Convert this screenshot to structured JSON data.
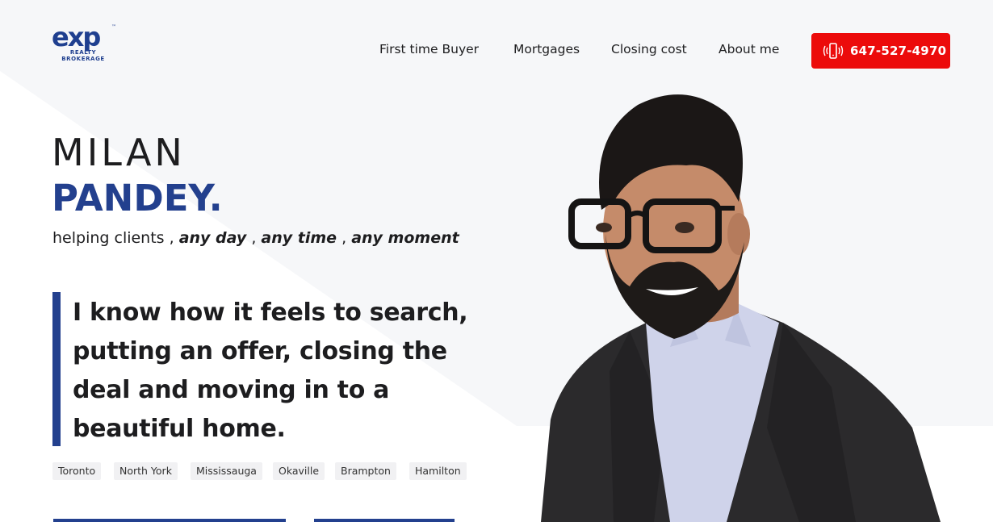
{
  "brand": {
    "logo_text": "exp",
    "logo_sub_line1": "REALTY",
    "logo_sub_line2": "BROKERAGE",
    "logo_tm": "™",
    "colors": {
      "primary": "#23408e",
      "accent": "#ec0b0b",
      "text": "#1d1d1f"
    }
  },
  "nav": {
    "items": [
      {
        "label": "First time Buyer"
      },
      {
        "label": "Mortgages"
      },
      {
        "label": "Closing cost"
      },
      {
        "label": "About me"
      }
    ],
    "phone_icon": "mobile-phone-ringing-icon",
    "phone": "647-527-4970"
  },
  "hero": {
    "first_name": "MILAN",
    "last_name": "PANDEY.",
    "tagline_prefix": "helping clients ,",
    "tagline_1": "any day",
    "tagline_sep1": ",",
    "tagline_2": "any time",
    "tagline_sep2": ",",
    "tagline_3": "any moment",
    "quote_line1": "I know how it feels to search,",
    "quote_line2": "putting an offer, closing the",
    "quote_line3": "deal and moving in to a",
    "quote_line4": "beautiful home."
  },
  "cities": [
    "Toronto",
    "North York",
    "Mississauga",
    "Okaville",
    "Brampton",
    "Hamilton"
  ]
}
